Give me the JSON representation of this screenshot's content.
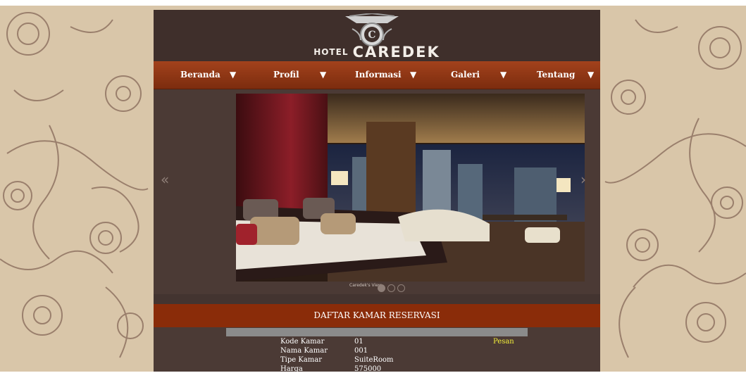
{
  "logo": {
    "emblem_letter": "C",
    "prefix": "HOTEL",
    "name": "CAREDEK"
  },
  "nav": {
    "items": [
      {
        "label": "Beranda"
      },
      {
        "label": "Profil"
      },
      {
        "label": "Informasi"
      },
      {
        "label": "Galeri"
      },
      {
        "label": "Tentang"
      }
    ],
    "caret": "▼"
  },
  "slider": {
    "prev_arrow": "«",
    "next_arrow": "›",
    "caption": "Caredek's View",
    "dots": 3,
    "active_dot": 0
  },
  "section": {
    "title": "DAFTAR KAMAR RESERVASI"
  },
  "room": {
    "fields": [
      {
        "label": "Kode Kamar",
        "value": "01"
      },
      {
        "label": "Nama Kamar",
        "value": "001"
      },
      {
        "label": "Tipe Kamar",
        "value": "SuiteRoom"
      },
      {
        "label": "Harga",
        "value": "575000"
      }
    ],
    "order_link": "Pesan"
  },
  "colors": {
    "page_bg": "#4b3a35",
    "header_bg": "#3f2f2b",
    "nav_bg": "#8a2c09",
    "banner_bg": "#8a2c09",
    "order_link": "#f2ee3a",
    "outer_bg": "#d9c6a9"
  }
}
